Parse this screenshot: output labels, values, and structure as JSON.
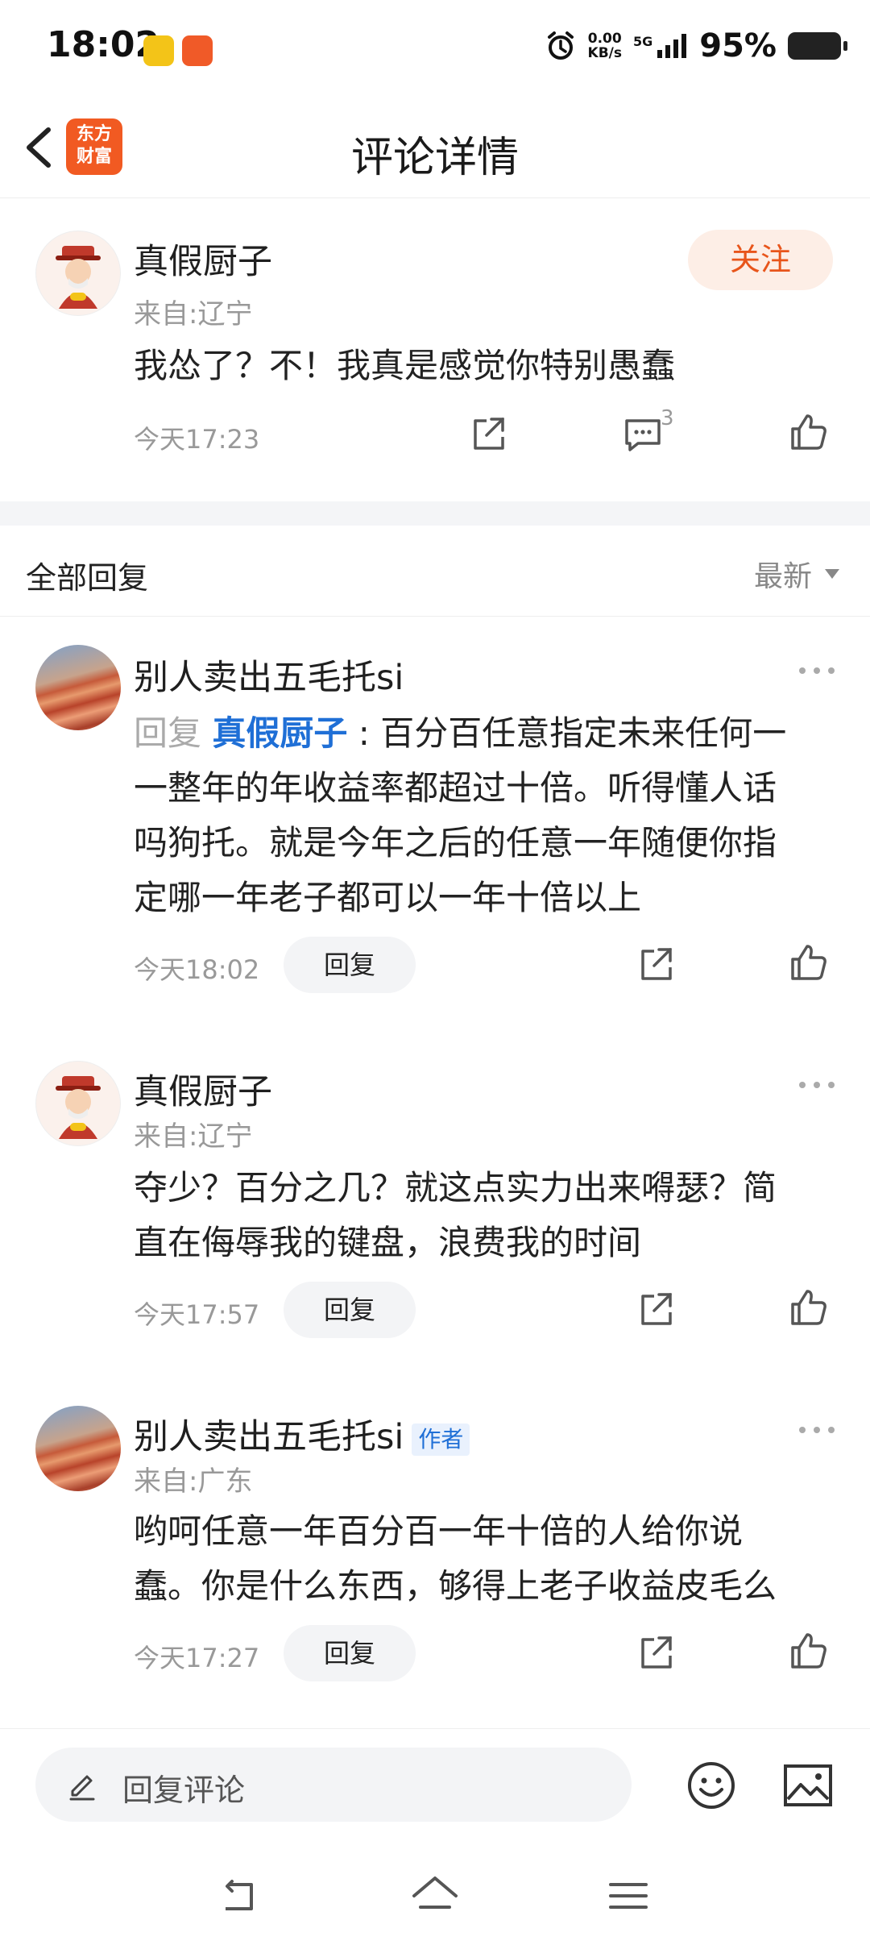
{
  "status_bar": {
    "time": "18:02",
    "net_speed_value": "0.00",
    "net_speed_unit": "KB/s",
    "network": "5G",
    "battery": "95%"
  },
  "header": {
    "title": "评论详情",
    "logo_line1": "东方",
    "logo_line2": "财富"
  },
  "main_comment": {
    "author": "真假厨子",
    "location": "来自:辽宁",
    "follow_label": "关注",
    "text": "我怂了？不！我真是感觉你特别愚蠢",
    "time": "今天17:23",
    "reply_count": "3"
  },
  "replies_section": {
    "title": "全部回复",
    "sort_label": "最新"
  },
  "replies": [
    {
      "author": "别人卖出五毛托si",
      "reply_prefix": "回复",
      "reply_to": "真假厨子",
      "text_lines": [
        "百分百任意指定未来任何一",
        "一整年的年收益率都超过十倍。听得懂人话",
        "吗狗托。就是今年之后的任意一年随便你指",
        "定哪一年老子都可以一年十倍以上"
      ],
      "time": "今天18:02",
      "reply_btn": "回复"
    },
    {
      "author": "真假厨子",
      "location": "来自:辽宁",
      "text_lines": [
        "夺少？百分之几？就这点实力出来嘚瑟？简",
        "直在侮辱我的键盘，浪费我的时间"
      ],
      "time": "今天17:57",
      "reply_btn": "回复"
    },
    {
      "author": "别人卖出五毛托si",
      "badge": "作者",
      "location": "来自:广东",
      "text_lines": [
        "哟呵任意一年百分百一年十倍的人给你说",
        "蠢。你是什么东西，够得上老子收益皮毛么"
      ],
      "time": "今天17:27",
      "reply_btn": "回复"
    }
  ],
  "bottom_bar": {
    "input_placeholder": "回复评论"
  },
  "colors": {
    "accent_orange": "#e8551b",
    "link_blue": "#1f6fd6",
    "logo_bg": "#f15a22"
  },
  "icons": [
    "back-arrow-icon",
    "share-icon",
    "comment-icon",
    "like-icon",
    "more-icon",
    "pencil-icon",
    "emoji-icon",
    "image-icon",
    "nav-back-icon",
    "nav-home-icon",
    "nav-menu-icon"
  ]
}
